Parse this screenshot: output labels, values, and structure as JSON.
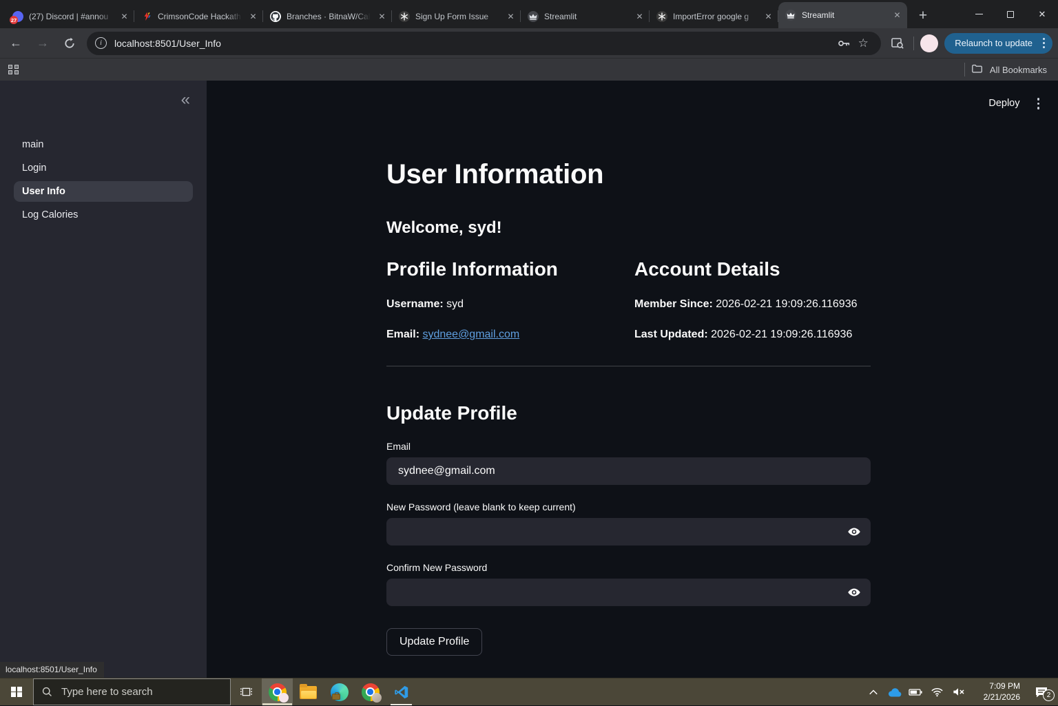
{
  "browser": {
    "tabs": [
      {
        "title": "(27) Discord | #annou",
        "badge": "27",
        "icon": "discord-icon"
      },
      {
        "title": "CrimsonCode Hackath",
        "icon": "crimsoncode-icon"
      },
      {
        "title": "Branches · BitnaW/Cal",
        "icon": "github-icon"
      },
      {
        "title": "Sign Up Form Issue",
        "icon": "chatgpt-icon"
      },
      {
        "title": "Streamlit",
        "icon": "streamlit-icon"
      },
      {
        "title": "ImportError google g",
        "icon": "chatgpt-icon"
      },
      {
        "title": "Streamlit",
        "icon": "streamlit-icon"
      }
    ],
    "url": "localhost:8501/User_Info",
    "relaunch_button": "Relaunch to update",
    "all_bookmarks_label": "All Bookmarks"
  },
  "app": {
    "deploy_label": "Deploy",
    "sidebar": {
      "items": [
        {
          "label": "main"
        },
        {
          "label": "Login"
        },
        {
          "label": "User Info"
        },
        {
          "label": "Log Calories"
        }
      ]
    },
    "page": {
      "title": "User Information",
      "welcome": "Welcome, syd!",
      "profile": {
        "heading": "Profile Information",
        "username_label": "Username:",
        "username": "syd",
        "email_label": "Email:",
        "email": "sydnee@gmail.com"
      },
      "account": {
        "heading": "Account Details",
        "member_since_label": "Member Since:",
        "member_since": "2026-02-21 19:09:26.116936",
        "last_updated_label": "Last Updated:",
        "last_updated": "2026-02-21 19:09:26.116936"
      },
      "form": {
        "heading": "Update Profile",
        "email_label": "Email",
        "email_value": "sydnee@gmail.com",
        "new_password_label": "New Password (leave blank to keep current)",
        "confirm_password_label": "Confirm New Password",
        "submit_label": "Update Profile"
      }
    },
    "status_tooltip": "localhost:8501/User_Info"
  },
  "taskbar": {
    "search_placeholder": "Type here to search",
    "clock": {
      "time": "7:09 PM",
      "date": "2/21/2026"
    },
    "notification_badge": "2"
  },
  "colors": {
    "app_background": "#0e1117",
    "sidebar_background": "#262730",
    "link_blue": "#5f9fe0",
    "relaunch_blue": "#20618f",
    "taskbar_olive": "#4b4738"
  }
}
